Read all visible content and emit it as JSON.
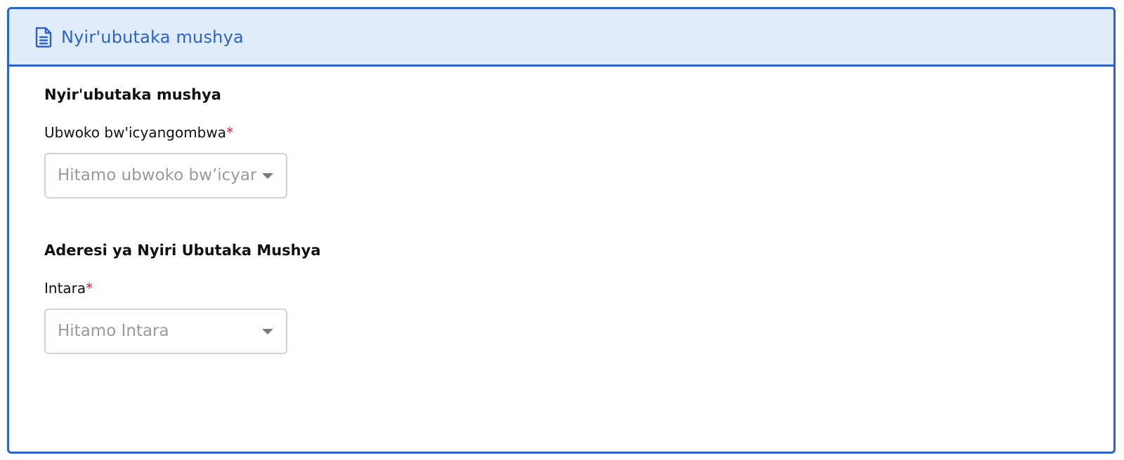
{
  "header": {
    "icon": "document-icon",
    "title": "Nyir'ubutaka mushya"
  },
  "section_owner": {
    "title": "Nyir'ubutaka mushya",
    "field_label": "Ubwoko bw'icyangombwa",
    "required_mark": "*",
    "select_placeholder": "Hitamo ubwoko bw’icyangombwa"
  },
  "section_address": {
    "title": "Aderesi ya Nyiri Ubutaka Mushya",
    "field_label": "Intara",
    "required_mark": "*",
    "select_placeholder": "Hitamo Intara"
  },
  "colors": {
    "accent": "#2d63c8",
    "header_bg": "#e0ecf9",
    "required": "#e0203a"
  }
}
